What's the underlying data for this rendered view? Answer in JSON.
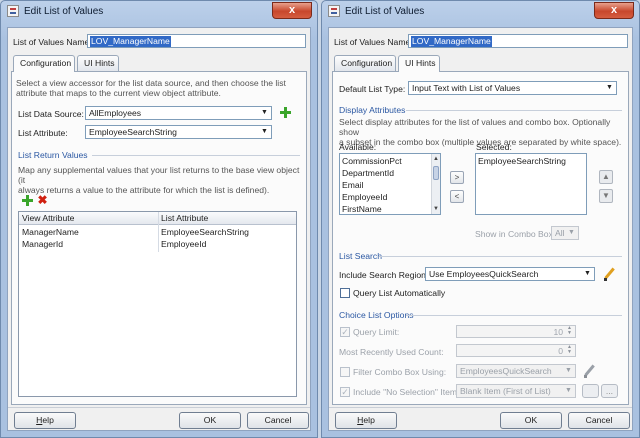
{
  "windows": {
    "left": {
      "title": "Edit List of Values",
      "close_symbol": "x",
      "name_label": "List of Values Name:",
      "name_value": "LOV_ManagerName",
      "tabs": [
        "Configuration",
        "UI Hints"
      ],
      "description": [
        "Select a view accessor for the list data source, and then choose the list",
        "attribute that maps to the current view object attribute."
      ],
      "data_source_label": "List Data Source:",
      "data_source_value": "AllEmployees",
      "list_attribute_label": "List Attribute:",
      "list_attribute_value": "EmployeeSearchString",
      "return_values_title": "List Return Values",
      "return_values_desc": [
        "Map any supplemental values that your list returns to the base view object (it",
        "always returns a value to the attribute for which the list is defined)."
      ],
      "table": {
        "columns": [
          "View Attribute",
          "List Attribute"
        ],
        "rows": [
          [
            "ManagerName",
            "EmployeeSearchString"
          ],
          [
            "ManagerId",
            "EmployeeId"
          ]
        ]
      },
      "buttons": {
        "help": "Help",
        "ok": "OK",
        "cancel": "Cancel"
      }
    },
    "right": {
      "title": "Edit List of Values",
      "close_symbol": "x",
      "name_label": "List of Values Name:",
      "name_value": "LOV_ManagerName",
      "tabs": [
        "Configuration",
        "UI Hints"
      ],
      "default_list_type_label": "Default List Type:",
      "default_list_type_value": "Input Text with List of Values",
      "display_attributes_title": "Display Attributes",
      "display_attributes_desc": [
        "Select display attributes for the list of values and combo box. Optionally show",
        "a subset in the combo box (multiple values are separated by white space)."
      ],
      "available_label": "Available:",
      "available_items": [
        "CommissionPct",
        "DepartmentId",
        "Email",
        "EmployeeId",
        "FirstName"
      ],
      "selected_label": "Selected:",
      "selected_items": [
        "EmployeeSearchString"
      ],
      "show_in_combo_label": "Show in Combo Box:",
      "show_in_combo_value": "All",
      "list_search_title": "List Search",
      "include_search_region_label": "Include Search Region:",
      "include_search_region_value": "Use EmployeesQuickSearch",
      "query_list_auto_label": "Query List Automatically",
      "choice_list_title": "Choice List Options",
      "query_limit_label": "Query Limit:",
      "query_limit_value": "10",
      "mru_label": "Most Recently Used Count:",
      "mru_value": "0",
      "filter_combo_label": "Filter Combo Box Using:",
      "filter_combo_value": "EmployeesQuickSearch",
      "no_selection_label": "Include \"No Selection\" Item:",
      "no_selection_value": "Blank Item (First of List)",
      "ellipsis": "...",
      "buttons": {
        "help": "Help",
        "ok": "OK",
        "cancel": "Cancel"
      }
    }
  }
}
